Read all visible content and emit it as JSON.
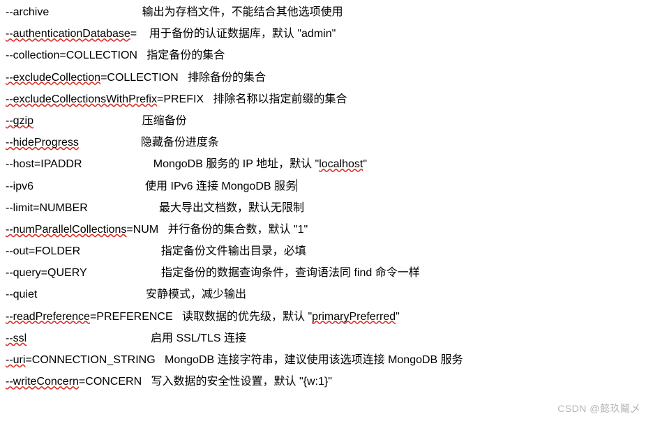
{
  "options": [
    {
      "flag": "--archive",
      "desc_pre": "输出为存档文件，不能结合其他选项使用",
      "flag_underline": false,
      "pad": "                              "
    },
    {
      "flag": "--authenticationDatabase",
      "eq": "=",
      "desc_pre": "    用于备份的认证数据库，默认 \"admin\"",
      "flag_underline": true
    },
    {
      "flag": "--collection=COLLECTION",
      "desc_pre": "   指定备份的集合",
      "flag_underline": false
    },
    {
      "flag": "--excludeCollection",
      "eq": "=COLLECTION",
      "desc_pre": "   排除备份的集合",
      "flag_underline": true
    },
    {
      "flag": "--excludeCollectionsWithPrefix",
      "eq": "=PREFIX",
      "desc_pre": "   排除名称以指定前缀的集合",
      "flag_underline": true
    },
    {
      "flag": "--gzip",
      "desc_pre": "压缩备份",
      "flag_underline": true,
      "pad": "                                   "
    },
    {
      "flag": "--hideProgress",
      "desc_pre": "隐藏备份进度条",
      "flag_underline": true,
      "pad": "                    "
    },
    {
      "flag": "--host=IPADDR",
      "desc_pre": " MongoDB 服务的 IP 地址，默认 \"",
      "desc_mid_underline": "localhost",
      "desc_post": "\"",
      "flag_underline": false,
      "pad": "                      "
    },
    {
      "flag": "--ipv6",
      "desc_pre": "使用 IPv6 连接 MongoDB 服务",
      "flag_underline": false,
      "pad": "                                    ",
      "has_cursor": true
    },
    {
      "flag": "--limit=NUMBER",
      "desc_pre": " 最大导出文档数，默认无限制",
      "flag_underline": false,
      "pad": "                      "
    },
    {
      "flag": "--numParallelCollections",
      "eq": "=NUM",
      "desc_pre": "   并行备份的集合数，默认 \"1\"",
      "flag_underline": true
    },
    {
      "flag": "--out=FOLDER",
      "desc_pre": " 指定备份文件输出目录，必填",
      "flag_underline": false,
      "pad": "                         "
    },
    {
      "flag": "--query=QUERY",
      "desc_pre": " 指定备份的数据查询条件，查询语法同 find 命令一样",
      "flag_underline": false,
      "pad": "                       "
    },
    {
      "flag": "--quiet",
      "desc_pre": "安静模式，减少输出",
      "flag_underline": false,
      "pad": "                                   "
    },
    {
      "flag": "--readPreference",
      "eq": "=PREFERENCE",
      "desc_pre": "   读取数据的优先级，默认 \"",
      "desc_mid_underline": "primaryPreferred",
      "desc_post": "\"",
      "flag_underline": true
    },
    {
      "flag": "--ssl",
      "desc_pre": "启用 SSL/TLS 连接",
      "flag_underline": true,
      "pad": "                                        "
    },
    {
      "flag": "--uri",
      "eq": "=CONNECTION_STRING",
      "desc_pre": "   MongoDB 连接字符串，建议使用该选项连接 MongoDB 服务",
      "flag_underline": true
    },
    {
      "flag": "--writeConcern",
      "eq": "=CONCERN",
      "desc_pre": "   写入数据的安全性设置，默认 \"{w:1}\"",
      "flag_underline": true
    }
  ],
  "watermark": "CSDN @懿玖鬮乄"
}
